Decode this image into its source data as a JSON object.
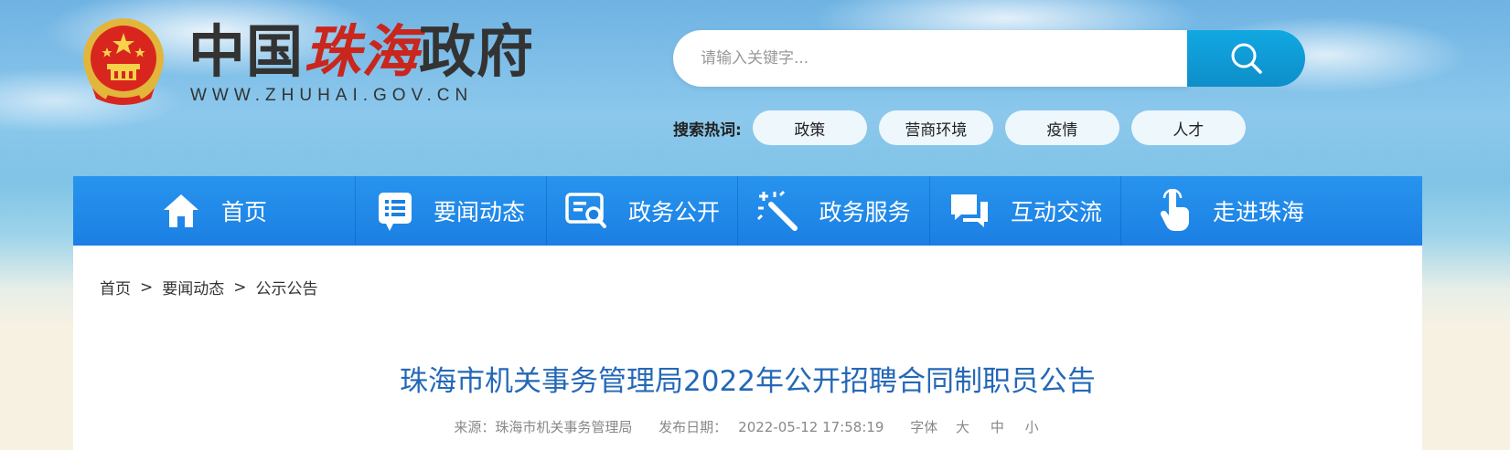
{
  "header": {
    "logo_text_part1": "中国",
    "logo_text_part2": "珠海",
    "logo_text_part3": "政府",
    "logo_url": "WWW.ZHUHAI.GOV.CN"
  },
  "search": {
    "placeholder": "请输入关键字..."
  },
  "hot_search": {
    "label": "搜索热词:",
    "tags": [
      "政策",
      "营商环境",
      "疫情",
      "人才"
    ]
  },
  "nav": {
    "items": [
      {
        "label": "首页",
        "icon": "home-icon"
      },
      {
        "label": "要闻动态",
        "icon": "news-list-icon"
      },
      {
        "label": "政务公开",
        "icon": "document-search-icon"
      },
      {
        "label": "政务服务",
        "icon": "magic-wand-icon"
      },
      {
        "label": "互动交流",
        "icon": "chat-bubbles-icon"
      },
      {
        "label": "走进珠海",
        "icon": "hand-pointer-icon"
      }
    ]
  },
  "breadcrumb": {
    "items": [
      "首页",
      "要闻动态",
      "公示公告"
    ],
    "separator": ">"
  },
  "article": {
    "title": "珠海市机关事务管理局2022年公开招聘合同制职员公告",
    "source": "来源：珠海市机关事务管理局",
    "date_label": "发布日期：",
    "date": "2022-05-12 17:58:19",
    "font_label": "字体",
    "font_large": "大",
    "font_medium": "中",
    "font_small": "小"
  },
  "colors": {
    "nav_blue": "#1b7fe3",
    "search_button": "#0e8ec9",
    "title_blue": "#2468b7",
    "logo_red": "#c9261d"
  }
}
